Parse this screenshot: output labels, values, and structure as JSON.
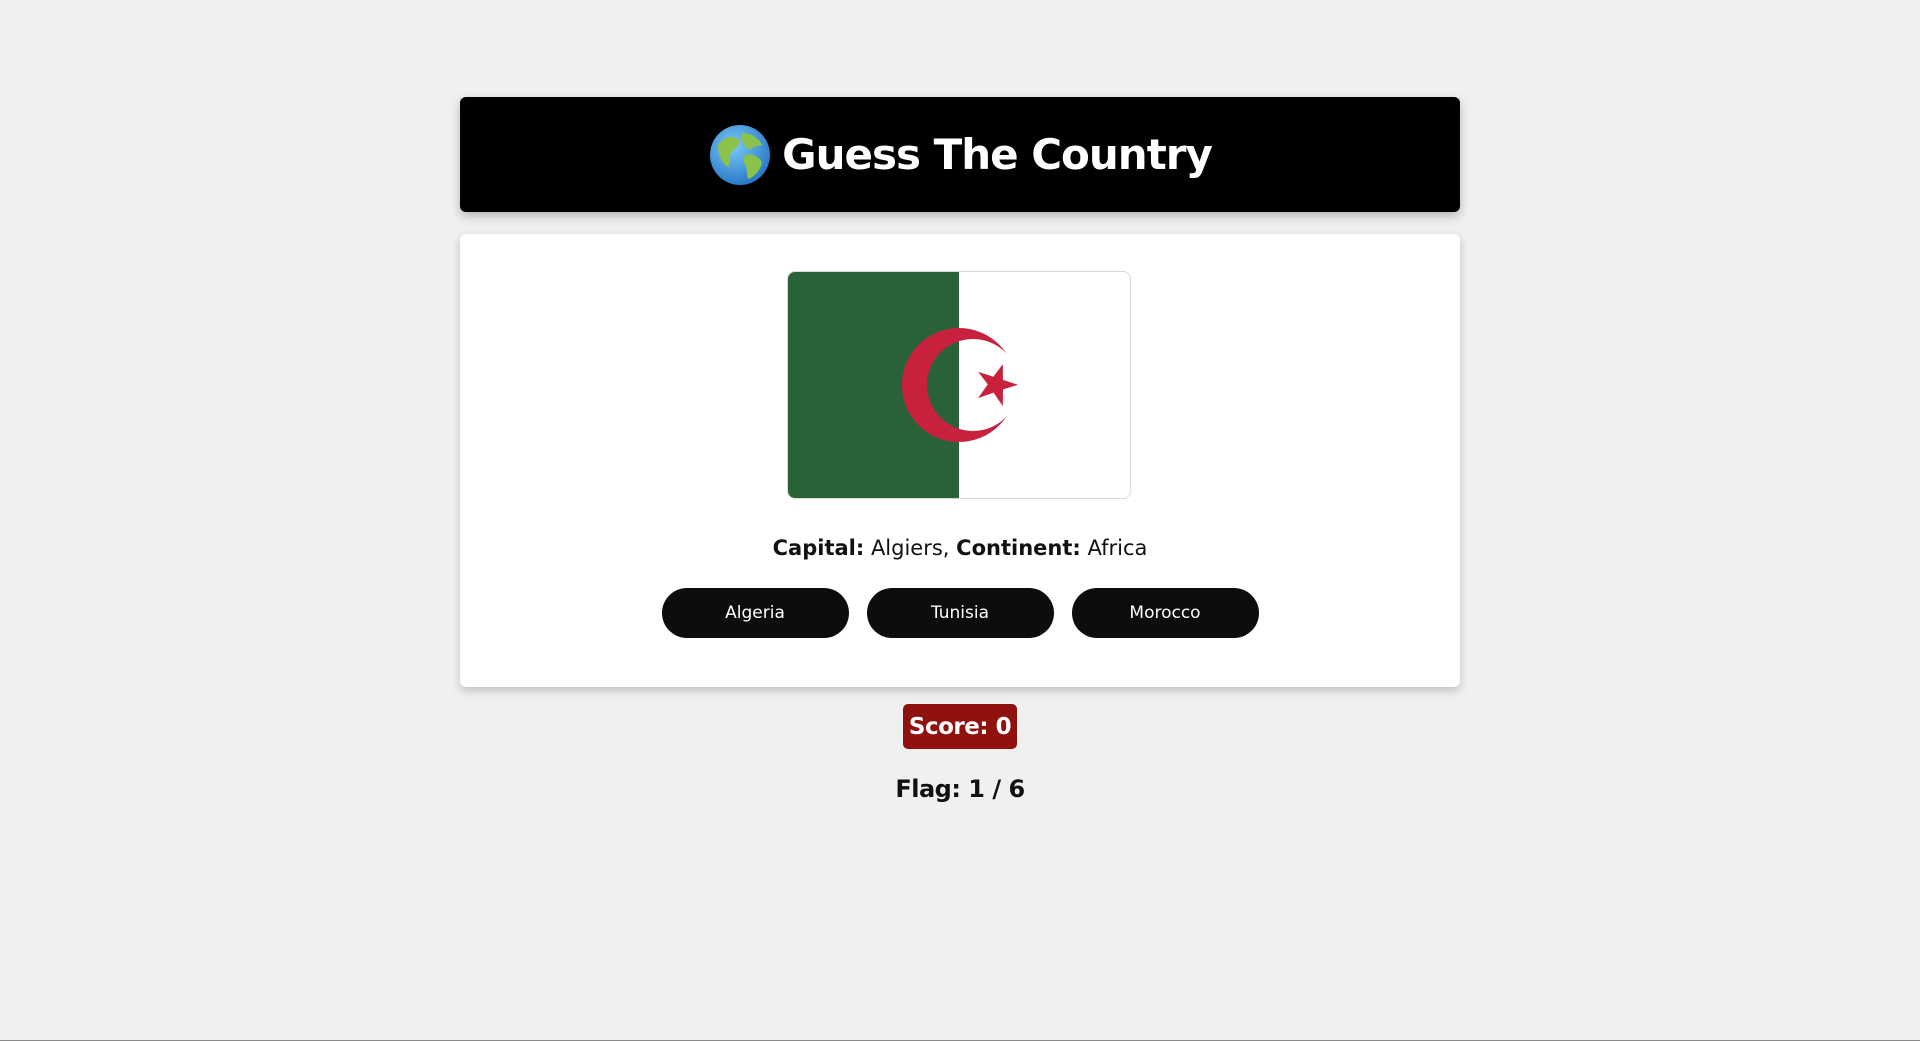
{
  "header": {
    "title": "Guess The Country",
    "icon": "globe-icon"
  },
  "question": {
    "flag_icon": "algeria-flag-icon",
    "capital_label": "Capital:",
    "capital_value": "Algiers,",
    "continent_label": "Continent:",
    "continent_value": "Africa"
  },
  "options": [
    {
      "label": "Algeria"
    },
    {
      "label": "Tunisia"
    },
    {
      "label": "Morocco"
    }
  ],
  "score": {
    "text": "Score: 0",
    "color": "#8f120e"
  },
  "progress": {
    "text": "Flag: 1 / 6"
  },
  "colors": {
    "header_bg": "#000000",
    "button_bg": "#0d0d0d",
    "page_bg": "#f0f0f0",
    "flag_green": "#296239",
    "flag_red": "#c8213d"
  }
}
